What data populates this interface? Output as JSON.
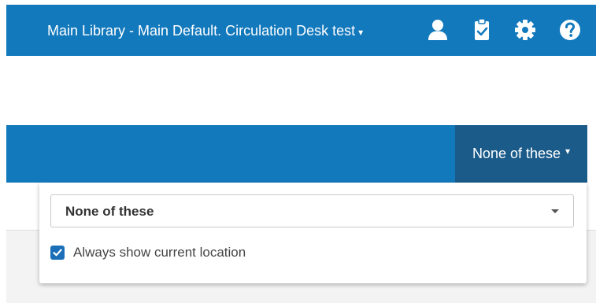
{
  "topbar": {
    "location_label": "Main Library - Main Default. Circulation Desk test",
    "location_caret": "▾",
    "icons": [
      "user-icon",
      "clipboard-check-icon",
      "gear-icon",
      "help-icon"
    ]
  },
  "subbar": {
    "toggle_label": "None of these",
    "toggle_caret": "▾"
  },
  "dropdown": {
    "selected_value": "None of these",
    "checkbox_label": "Always show current location",
    "checkbox_checked": true
  },
  "colors": {
    "header_blue": "#1379bd",
    "active_toggle": "#1b5b8a",
    "checkbox_blue": "#1b6fb8"
  }
}
